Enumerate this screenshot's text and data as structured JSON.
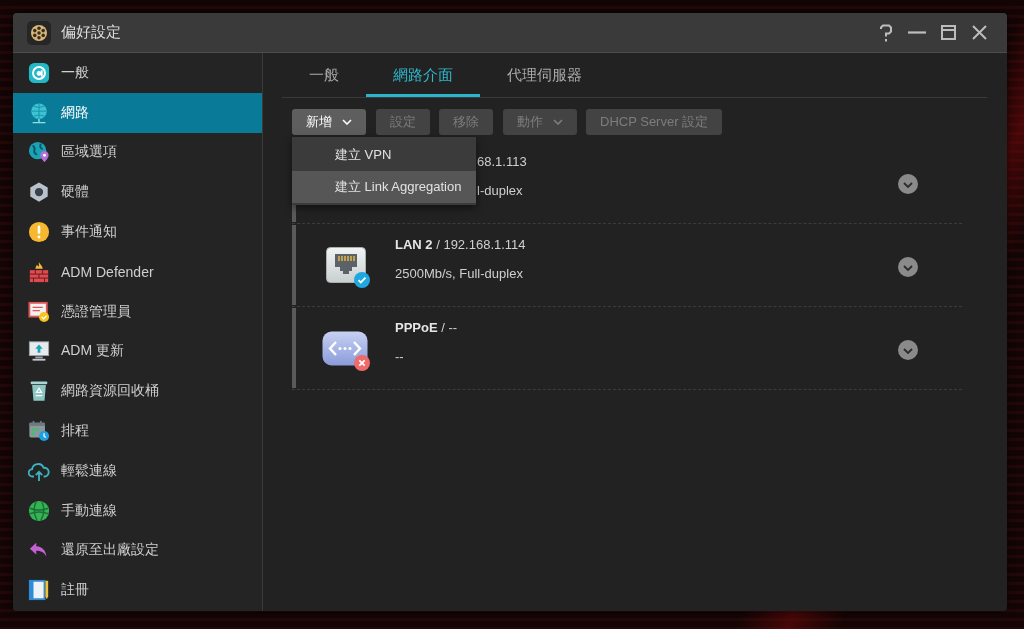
{
  "window": {
    "title": "偏好設定"
  },
  "sidebar": {
    "items": [
      {
        "label": "一般",
        "selected": false
      },
      {
        "label": "網路",
        "selected": true
      },
      {
        "label": "區域選項",
        "selected": false
      },
      {
        "label": "硬體",
        "selected": false
      },
      {
        "label": "事件通知",
        "selected": false
      },
      {
        "label": "ADM Defender",
        "selected": false
      },
      {
        "label": "憑證管理員",
        "selected": false
      },
      {
        "label": "ADM 更新",
        "selected": false
      },
      {
        "label": "網路資源回收桶",
        "selected": false
      },
      {
        "label": "排程",
        "selected": false
      },
      {
        "label": "輕鬆連線",
        "selected": false
      },
      {
        "label": "手動連線",
        "selected": false
      },
      {
        "label": "還原至出廠設定",
        "selected": false
      },
      {
        "label": "註冊",
        "selected": false
      }
    ]
  },
  "tabs": [
    {
      "label": "一般",
      "selected": false
    },
    {
      "label": "網路介面",
      "selected": true
    },
    {
      "label": "代理伺服器",
      "selected": false
    }
  ],
  "toolbar": {
    "buttons": [
      {
        "label": "新增",
        "kind": "dropdown",
        "disabled": false,
        "expanded": true
      },
      {
        "label": "設定",
        "kind": "plain",
        "disabled": true,
        "expanded": false
      },
      {
        "label": "移除",
        "kind": "plain",
        "disabled": true,
        "expanded": false
      },
      {
        "label": "動作",
        "kind": "dropdown",
        "disabled": true,
        "expanded": false
      },
      {
        "label": "DHCP Server 設定",
        "kind": "plain",
        "disabled": true,
        "expanded": false
      }
    ],
    "menu": {
      "items": [
        {
          "label": "建立 VPN",
          "selected": false
        },
        {
          "label": "建立 Link Aggregation",
          "selected": true
        }
      ]
    }
  },
  "interfaces": [
    {
      "title": "68.1.113",
      "detail": "l-duplex"
    },
    {
      "kind": "ethernet",
      "connected": true,
      "title": "**LAN 2** / 192.168.1.114",
      "detail": "2500Mb/s, Full-duplex"
    },
    {
      "kind": "pppoe",
      "connected": false,
      "title": "**PPPoE** / --",
      "detail": "--"
    }
  ]
}
